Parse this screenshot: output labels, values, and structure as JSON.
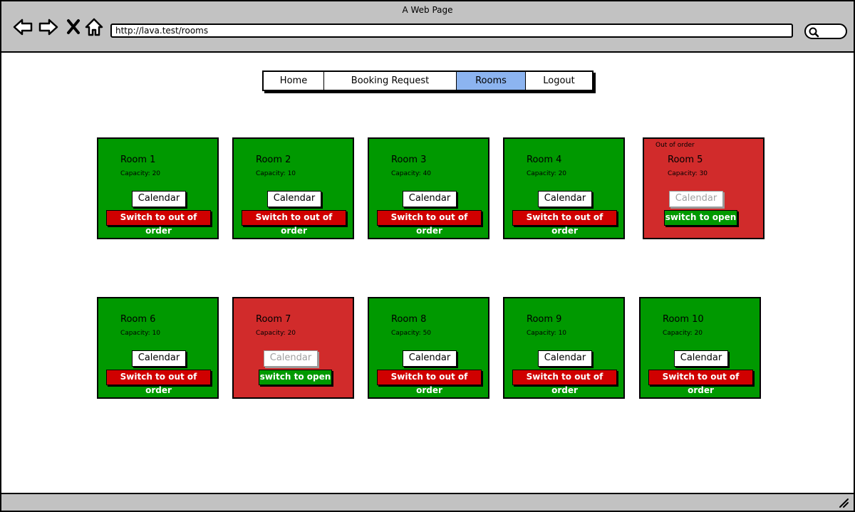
{
  "window": {
    "title": "A Web Page"
  },
  "browser": {
    "url": "http://lava.test/rooms"
  },
  "nav": {
    "items": [
      {
        "label": "Home",
        "active": false
      },
      {
        "label": "Booking Request",
        "active": false
      },
      {
        "label": "Rooms",
        "active": true
      },
      {
        "label": "Logout",
        "active": false
      }
    ]
  },
  "rooms": [
    {
      "name": "Room 1",
      "capacity": "Capacity: 20",
      "status_text": "",
      "calendar": "Calendar",
      "action": "Switch to out of order"
    },
    {
      "name": "Room 2",
      "capacity": "Capacity: 10",
      "status_text": "",
      "calendar": "Calendar",
      "action": "Switch to out of order"
    },
    {
      "name": "Room 3",
      "capacity": "Capacity: 40",
      "status_text": "",
      "calendar": "Calendar",
      "action": "Switch to out of order"
    },
    {
      "name": "Room 4",
      "capacity": "Capacity: 20",
      "status_text": "",
      "calendar": "Calendar",
      "action": "Switch to out of order"
    },
    {
      "name": "Room 5",
      "capacity": "Capacity: 30",
      "status_text": "Out of order",
      "calendar": "Calendar",
      "action": "switch to open"
    },
    {
      "name": "Room 6",
      "capacity": "Capacity: 10",
      "status_text": "",
      "calendar": "Calendar",
      "action": "Switch to out of order"
    },
    {
      "name": "Room 7",
      "capacity": "Capacity: 20",
      "status_text": "",
      "calendar": "Calendar",
      "action": "switch to open"
    },
    {
      "name": "Room 8",
      "capacity": "Capacity: 50",
      "status_text": "",
      "calendar": "Calendar",
      "action": "Switch to out of order"
    },
    {
      "name": "Room 9",
      "capacity": "Capacity: 10",
      "status_text": "",
      "calendar": "Calendar",
      "action": "Switch to out of order"
    },
    {
      "name": "Room 10",
      "capacity": "Capacity: 20",
      "status_text": "",
      "calendar": "Calendar",
      "action": "Switch to out of order"
    }
  ],
  "colors": {
    "open_card": "#009900",
    "out_of_order_card": "#d12b2b",
    "active_tab": "#8cb4f0",
    "chrome": "#c2c2c2",
    "out_of_order_button": "#d00000"
  },
  "icons": [
    "back-arrow-icon",
    "forward-arrow-icon",
    "close-icon",
    "home-icon",
    "search-icon",
    "resize-grip-icon"
  ]
}
